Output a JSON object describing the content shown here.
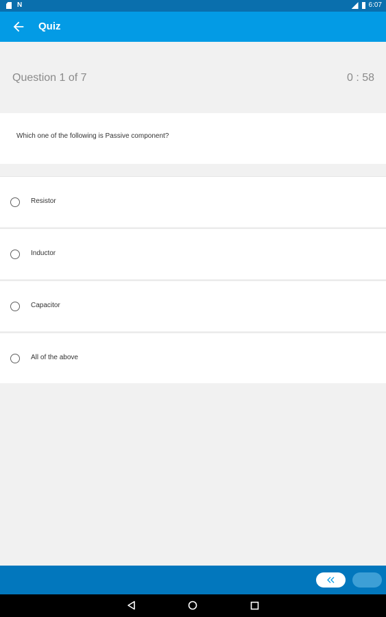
{
  "status_bar": {
    "time": "6:07",
    "icons": [
      "sd-card-icon",
      "n-icon",
      "signal-icon",
      "battery-icon"
    ]
  },
  "app_bar": {
    "title": "Quiz",
    "back_icon": "arrow-left-icon"
  },
  "question_header": {
    "counter": "Question 1 of  7",
    "timer": "0 : 58"
  },
  "question": {
    "text": "Which one of the following is Passive component?"
  },
  "options": [
    {
      "label": "Resistor",
      "selected": false
    },
    {
      "label": "Inductor",
      "selected": false
    },
    {
      "label": "Capacitor",
      "selected": false
    },
    {
      "label": "All of the above",
      "selected": false
    }
  ],
  "bottom_bar": {
    "prev_icon": "double-chevron-left-icon",
    "next_button": "next-button"
  },
  "nav_bar": {
    "icons": [
      "back-triangle-icon",
      "home-circle-icon",
      "recent-square-icon"
    ]
  },
  "colors": {
    "status_bar": "#0a6fad",
    "app_bar": "#039be5",
    "bottom_bar": "#0277bd",
    "background": "#f1f1f1"
  }
}
